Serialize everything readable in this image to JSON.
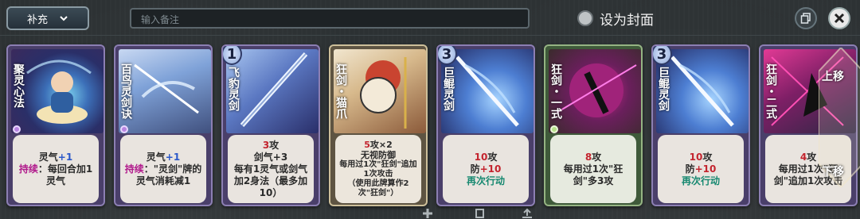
{
  "top": {
    "dropdown_label": "补充",
    "note_placeholder": "输入备注",
    "cover_label": "设为封面"
  },
  "cards": [
    {
      "name": "聚灵心法",
      "cost": "",
      "lines": [
        [
          "灵气",
          "+1"
        ],
        [
          "持续",
          "：每回合加1灵气"
        ]
      ]
    },
    {
      "name": "百鸟灵剑诀",
      "cost": "",
      "lines": [
        [
          "灵气",
          "+1"
        ],
        [
          "持续",
          "：\"灵剑\"牌的灵气消耗减1"
        ]
      ]
    },
    {
      "name": "飞豹灵剑",
      "cost": "1",
      "lines": [
        [
          "3",
          "攻"
        ],
        [
          "剑气+3"
        ],
        [
          "每有1灵气或剑气加2身法（最多加10）"
        ]
      ]
    },
    {
      "name": "狂剑・猫爪",
      "cost": "",
      "lines": [
        [
          "5",
          "攻×2"
        ],
        [
          "无视防御"
        ],
        [
          "每用过1次\"狂剑\"追加1次攻击"
        ],
        [
          "（使用此牌算作2次\"狂剑\"）"
        ]
      ]
    },
    {
      "name": "巨鲲灵剑",
      "cost": "3",
      "lines": [
        [
          "10",
          "攻"
        ],
        [
          "防",
          "+10"
        ],
        [
          "再次行动"
        ]
      ]
    },
    {
      "name": "狂剑・一式",
      "cost": "",
      "lines": [
        [
          "8",
          "攻"
        ],
        [
          "每用过1次\"狂剑\"多3攻"
        ]
      ]
    },
    {
      "name": "巨鲲灵剑",
      "cost": "3",
      "lines": [
        [
          "10",
          "攻"
        ],
        [
          "防",
          "+10"
        ],
        [
          "再次行动"
        ]
      ]
    },
    {
      "name": "狂剑・二式",
      "cost": "",
      "lines": [
        [
          "4",
          "攻"
        ],
        [
          "每用过1次\"狂剑\"追加1次攻击"
        ]
      ]
    }
  ],
  "overlay": {
    "up": "上移",
    "down": "下移"
  },
  "colors": {
    "accent_red": "#c3242e",
    "accent_blue": "#2b58c9",
    "accent_teal": "#168870"
  },
  "icons": [
    "chevron-down-icon",
    "copy-icon",
    "close-icon",
    "plus-icon"
  ]
}
